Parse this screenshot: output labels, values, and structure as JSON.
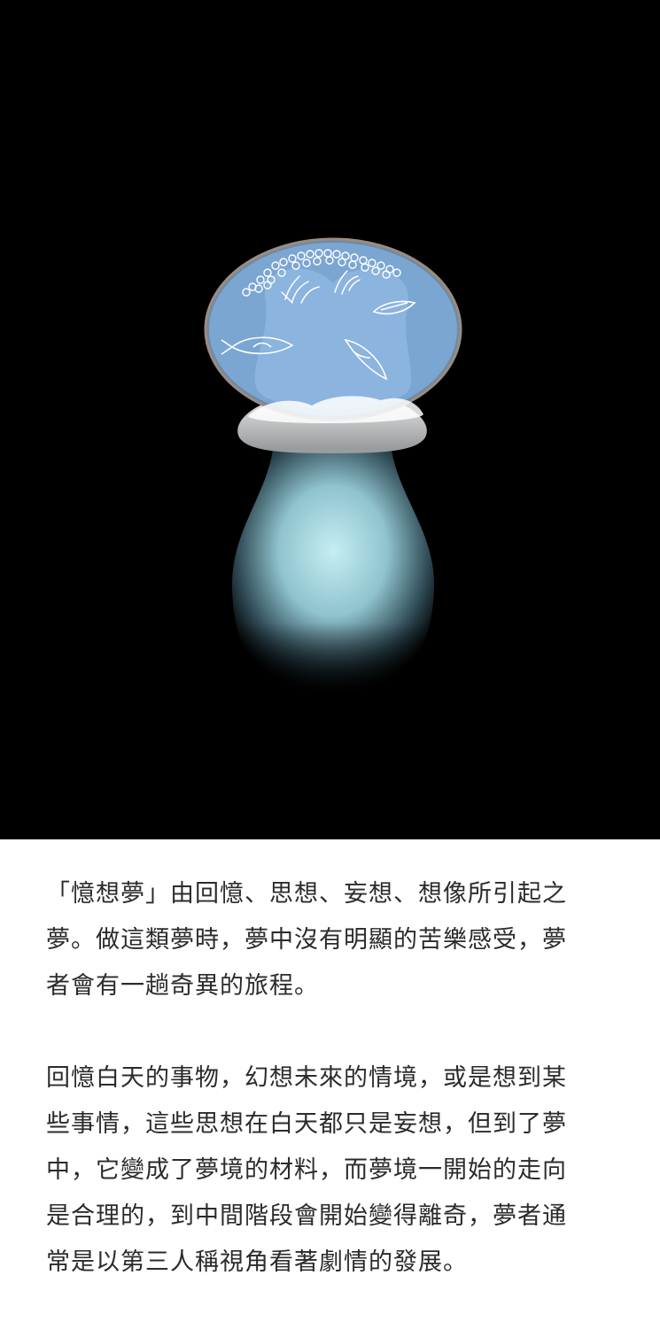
{
  "illustration": {
    "background_color": "#000000",
    "head_color": "#7ea8d4",
    "body_glow_color": "#bfe8ec",
    "motifs": [
      "bubble-cluster",
      "seaweed-icon",
      "fish-icon",
      "leaf-icon"
    ]
  },
  "article": {
    "paragraphs": [
      {
        "lines": [
          "「憶想夢」由回憶、思想、妄想、想像所引起之",
          "夢。做這類夢時，夢中沒有明顯的苦樂感受，夢",
          "者會有一趟奇異的旅程。"
        ]
      },
      {
        "lines": [
          "回憶白天的事物，幻想未來的情境，或是想到某",
          "些事情，這些思想在白天都只是妄想，但到了夢",
          "中，它變成了夢境的材料，而夢境一開始的走向",
          "是合理的，到中間階段會開始變得離奇，夢者通",
          "常是以第三人稱視角看著劇情的發展。"
        ]
      }
    ]
  }
}
